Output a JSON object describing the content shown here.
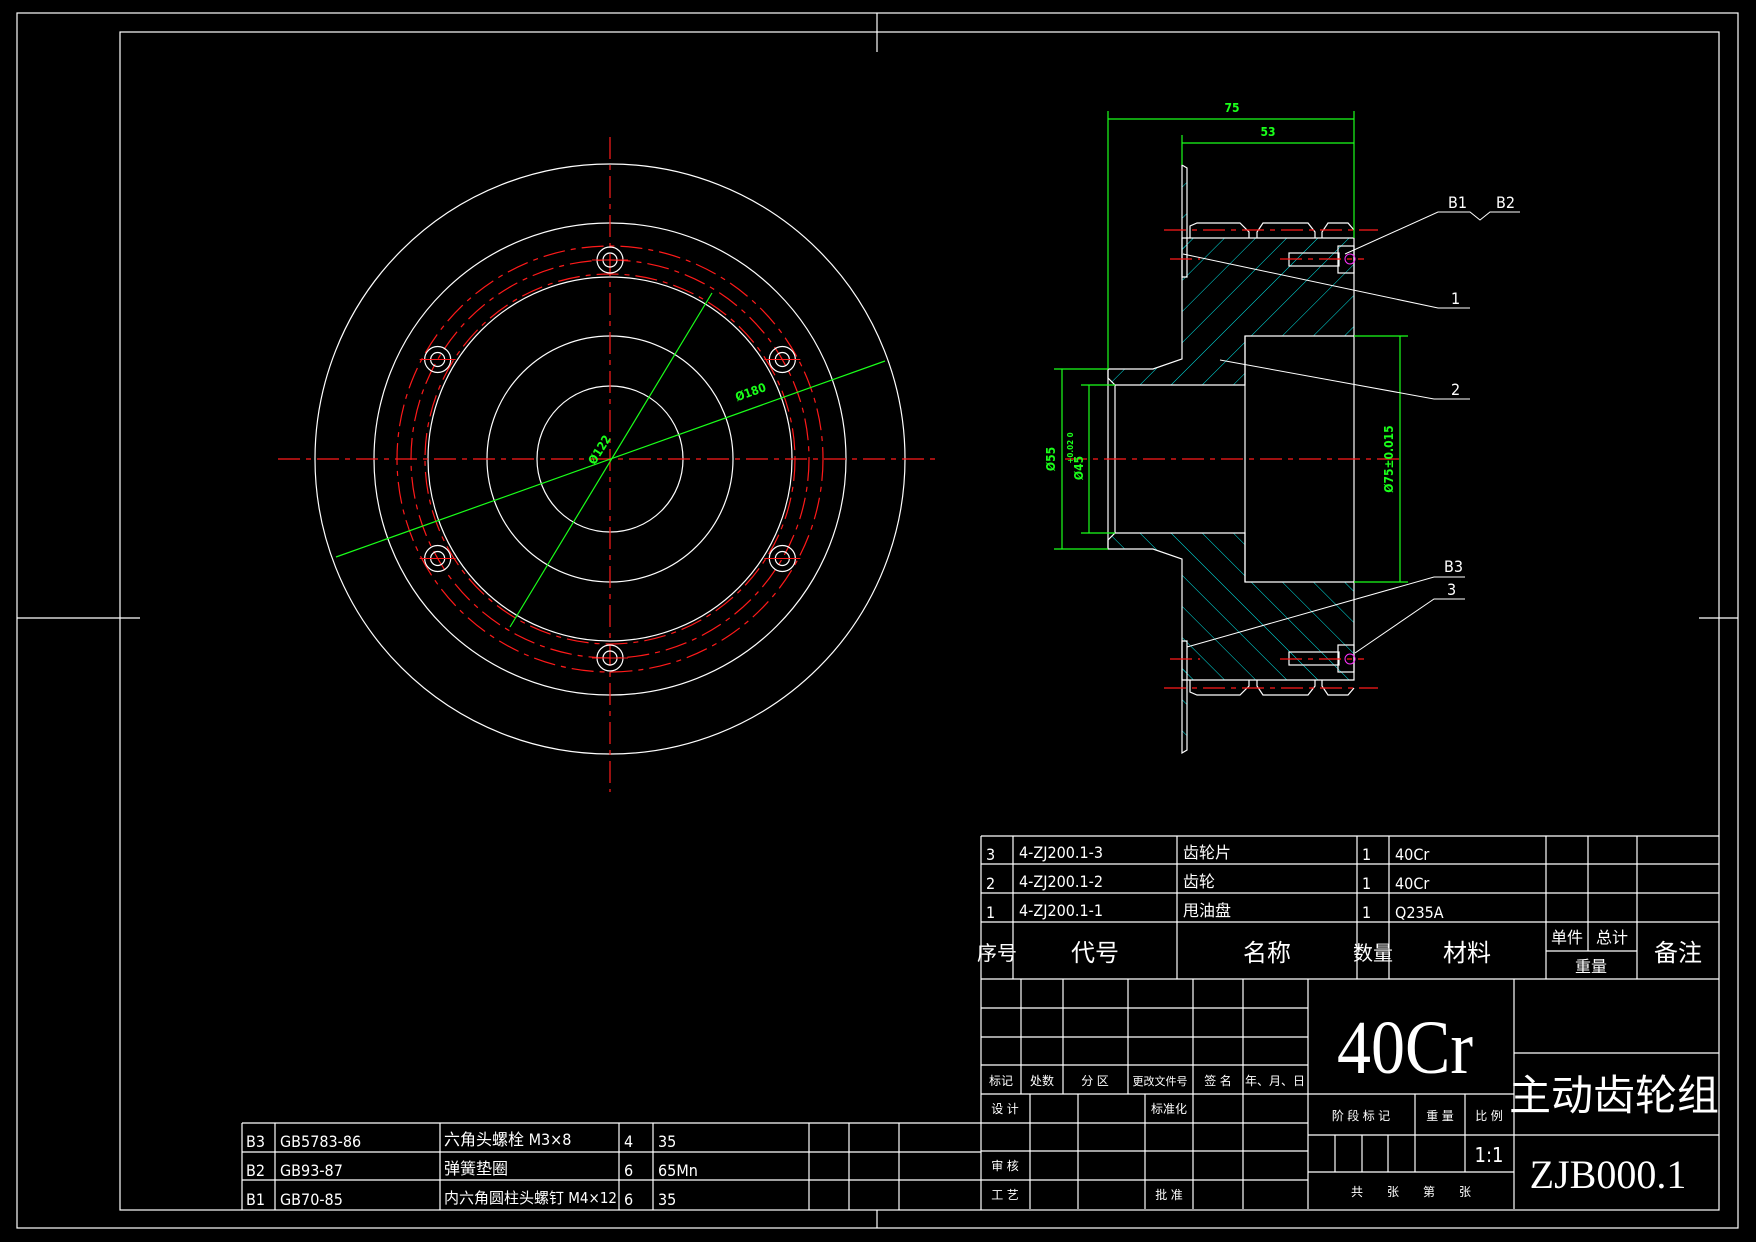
{
  "colors": {
    "background": "#000000",
    "lines": "#ffffff",
    "centerlines": "#ff1a1a",
    "dimensions": "#1aff1a",
    "hatch": "#00e5e5"
  },
  "front_view": {
    "dims": {
      "outer": "Ø180",
      "inner": "Ø122"
    }
  },
  "section_view": {
    "dims": {
      "overall_length": "75",
      "gear_length": "53",
      "hub_dia": "Ø55",
      "bore_dia": "Ø45",
      "bore_tol": "+0.02 0",
      "big_bore": "Ø75±0.015"
    },
    "balloons": {
      "b1": "B1",
      "b2": "B2",
      "b3": "B3",
      "p1": "1",
      "p2": "2",
      "p3": "3"
    }
  },
  "bom": {
    "rows": [
      {
        "no": "3",
        "code": "4-ZJ200.1-3",
        "name": "齿轮片",
        "qty": "1",
        "material": "40Cr"
      },
      {
        "no": "2",
        "code": "4-ZJ200.1-2",
        "name": "齿轮",
        "qty": "1",
        "material": "40Cr"
      },
      {
        "no": "1",
        "code": "4-ZJ200.1-1",
        "name": "甩油盘",
        "qty": "1",
        "material": "Q235A"
      }
    ],
    "headers": {
      "no": "序号",
      "code": "代号",
      "name": "名称",
      "qty": "数量",
      "material": "材料",
      "unit": "单件",
      "total": "总计",
      "weight": "重量",
      "remark": "备注"
    }
  },
  "std_parts": [
    {
      "no": "B3",
      "code": "GB5783-86",
      "name": "六角头螺栓 M3×8",
      "qty": "4",
      "material": "35"
    },
    {
      "no": "B2",
      "code": "GB93-87",
      "name": "弹簧垫圈",
      "qty": "6",
      "material": "65Mn"
    },
    {
      "no": "B1",
      "code": "GB70-85",
      "name": "内六角圆柱头螺钉 M4×12",
      "qty": "6",
      "material": "35"
    }
  ],
  "title_block": {
    "labels": {
      "mark": "标记",
      "count": "处数",
      "zone": "分 区",
      "doc_no": "更改文件号",
      "sign": "签 名",
      "date": "年、月、日",
      "design": "设 计",
      "standard": "标准化",
      "review": "审 核",
      "process": "工 艺",
      "approve": "批 准",
      "stage": "阶 段 标 记",
      "weight": "重 量",
      "scale": "比 例",
      "sheets": "共　　张　　第　　张"
    },
    "material": "40Cr",
    "scale_value": "1:1",
    "part_name": "主动齿轮组",
    "drawing_no": "ZJB000.1"
  }
}
